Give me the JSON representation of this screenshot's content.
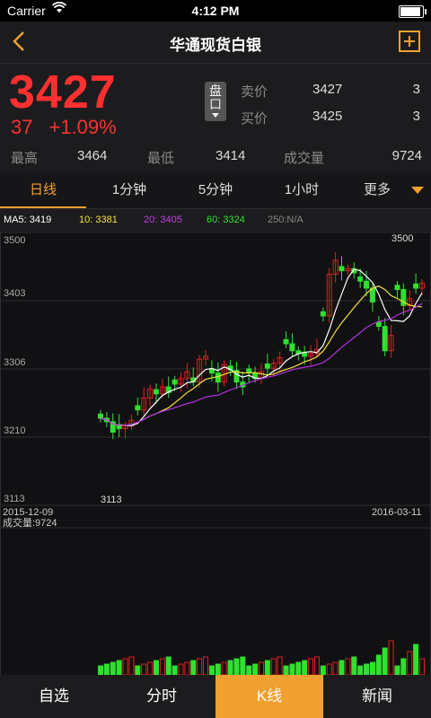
{
  "status": {
    "carrier": "Carrier",
    "time": "4:12 PM"
  },
  "nav": {
    "title": "华通现货白银"
  },
  "quote": {
    "price": "3427",
    "change": "37",
    "change_pct": "+1.09%",
    "pankou_label": "盘口",
    "sell": {
      "label": "卖价",
      "price": "3427",
      "qty": "3"
    },
    "buy": {
      "label": "买价",
      "price": "3425",
      "qty": "3"
    },
    "high_label": "最高",
    "high": "3464",
    "low_label": "最低",
    "low": "3414",
    "volume_label": "成交量",
    "volume": "9724"
  },
  "tabs": [
    "日线",
    "1分钟",
    "5分钟",
    "1小时",
    "更多"
  ],
  "ma": {
    "ma5": "MA5: 3419",
    "ma10": "10: 3381",
    "ma20": "20: 3405",
    "ma60": "60: 3324",
    "ma250": "250:N/A"
  },
  "colors": {
    "up": "#e02020",
    "down": "#30e030",
    "accent": "#f0a030",
    "ma5": "#ffffff",
    "ma10": "#f5e23c",
    "ma20": "#b030e0",
    "ma60": "#30e030",
    "ma250": "#888888"
  },
  "chart_data": {
    "type": "candlestick",
    "y_ticks": [
      "3500",
      "3403",
      "3306",
      "3210",
      "3113"
    ],
    "ylim": [
      3113,
      3500
    ],
    "x_start": "2015-12-09",
    "x_end": "2016-03-11",
    "max_label": "3500",
    "min_label": "3113",
    "volume_label": "成交量:9724"
  },
  "bottom_tabs": [
    "自选",
    "分时",
    "K线",
    "新闻"
  ]
}
